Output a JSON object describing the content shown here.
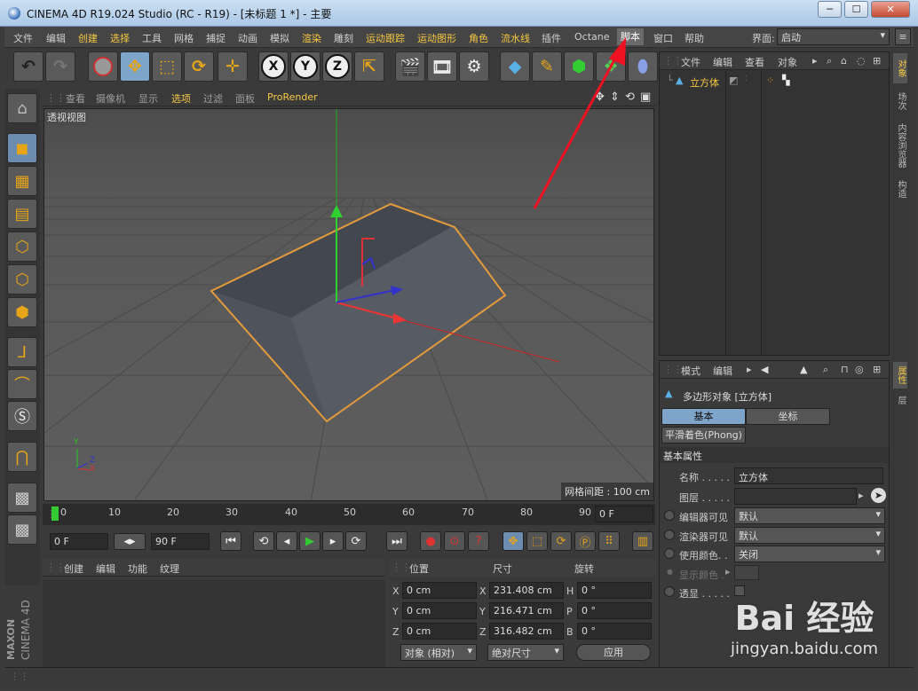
{
  "window": {
    "title": "CINEMA 4D R19.024 Studio (RC - R19) - [未标题 1 *] - 主要",
    "btn_min": "─",
    "btn_max": "☐",
    "btn_close": "✕"
  },
  "menu": [
    "文件",
    "编辑",
    "创建",
    "选择",
    "工具",
    "网格",
    "捕捉",
    "动画",
    "模拟",
    "渲染",
    "雕刻",
    "运动跟踪",
    "运动图形",
    "角色",
    "流水线",
    "插件",
    "Octane",
    "脚本",
    "窗口",
    "帮助"
  ],
  "layout": {
    "label": "界面:",
    "value": "启动"
  },
  "viewport": {
    "menu": [
      "查看",
      "摄像机",
      "显示",
      "选项",
      "过滤",
      "面板",
      "ProRender"
    ],
    "label": "透视视图",
    "grid_spacing": "网格间距 : 100 cm",
    "axis": {
      "x": "X",
      "y": "Y",
      "z": "Z"
    }
  },
  "timeline": {
    "ticks": [
      "0",
      "10",
      "20",
      "30",
      "40",
      "50",
      "60",
      "70",
      "80",
      "90"
    ],
    "current": "0 F"
  },
  "playback": {
    "start": "0 F",
    "end": "90 F"
  },
  "material": {
    "menu": [
      "创建",
      "编辑",
      "功能",
      "纹理"
    ]
  },
  "coords": {
    "headers": [
      "位置",
      "尺寸",
      "旋转"
    ],
    "rows": [
      {
        "a": "X",
        "pos": "0 cm",
        "b": "X",
        "size": "231.408 cm",
        "c": "H",
        "rot": "0 °"
      },
      {
        "a": "Y",
        "pos": "0 cm",
        "b": "Y",
        "size": "216.471 cm",
        "c": "P",
        "rot": "0 °"
      },
      {
        "a": "Z",
        "pos": "0 cm",
        "b": "Z",
        "size": "316.482 cm",
        "c": "B",
        "rot": "0 °"
      }
    ],
    "mode": "对象 (相对)",
    "size_mode": "绝对尺寸",
    "apply": "应用"
  },
  "objects": {
    "menu": [
      "文件",
      "编辑",
      "查看",
      "对象"
    ],
    "item": "立方体"
  },
  "attributes": {
    "menu": [
      "模式",
      "编辑"
    ],
    "title": "多边形对象 [立方体]",
    "tabs": [
      "基本",
      "坐标"
    ],
    "phong": "平滑着色(Phong)",
    "section": "基本属性",
    "name_label": "名称 . . . . .",
    "name_value": "立方体",
    "layer_label": "图层 . . . . .",
    "editor_vis_label": "编辑器可见",
    "editor_vis": "默认",
    "render_vis_label": "渲染器可见",
    "render_vis": "默认",
    "use_color_label": "使用颜色. .",
    "use_color": "关闭",
    "display_color_label": "显示颜色 .",
    "xray_label": "透显 . . . . ."
  },
  "right_tabs": [
    "对象",
    "场次",
    "内容浏览器",
    "构造",
    "属性",
    "层"
  ],
  "maxon": {
    "brand": "MAXON",
    "product": "CINEMA 4D"
  },
  "watermark": {
    "brand": "Bai 经验",
    "url": "jingyan.baidu.com"
  }
}
